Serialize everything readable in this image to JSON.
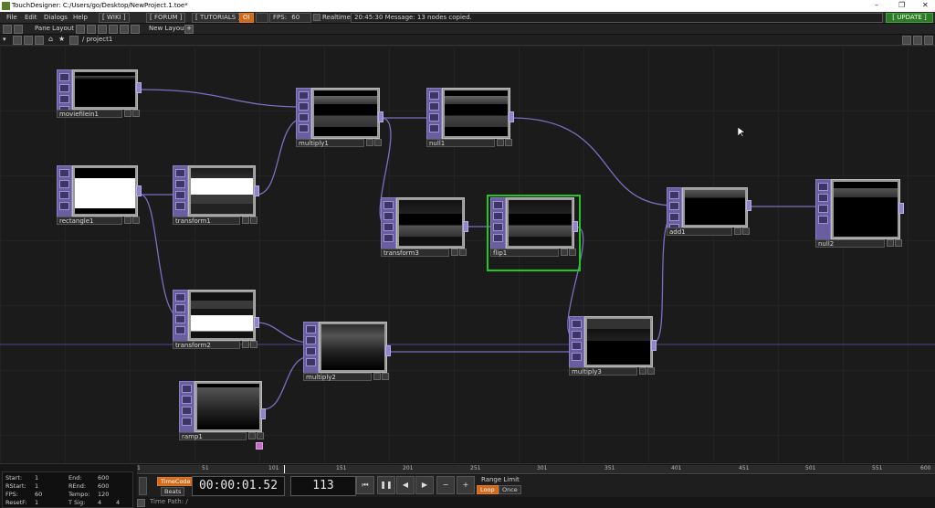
{
  "window": {
    "title": "TouchDesigner: C:/Users/go/Desktop/NewProject.1.toe*"
  },
  "menu": {
    "items": [
      "File",
      "Edit",
      "Dialogs",
      "Help"
    ],
    "wiki": "[ WIKI ]",
    "forum": "[ FORUM ]",
    "tutorials": "[ TUTORIALS ]",
    "oi": "OI",
    "fps_label": "FPS:",
    "fps_value": "60",
    "realtime": "Realtime",
    "message": "20:45:30 Message: 13 nodes copied.",
    "update": "[ UPDATE ]"
  },
  "panebar": {
    "pane_layout": "Pane Layout",
    "new_layout": "New Layout"
  },
  "pathbar": {
    "path": "/ project1"
  },
  "nodes": {
    "moviefilein1": "moviefilein1",
    "rectangle1": "rectangle1",
    "transform1": "transform1",
    "transform2": "transform2",
    "ramp1": "ramp1",
    "multiply1": "multiply1",
    "null1": "null1",
    "transform3": "transform3",
    "flip1": "flip1",
    "multiply2": "multiply2",
    "multiply3": "multiply3",
    "add1": "add1",
    "null2": "null2"
  },
  "stats": {
    "start_label": "Start:",
    "start_value": "1",
    "end_label": "End:",
    "end_value": "600",
    "rstart_label": "RStart:",
    "rstart_value": "1",
    "rend_label": "REnd:",
    "rend_value": "600",
    "fps_label": "FPS:",
    "fps_value": "60",
    "tempo_label": "Tempo:",
    "tempo_value": "120",
    "resetf_label": "ResetF:",
    "resetf_value": "1",
    "tsig_label": "T Sig:",
    "tsig_a": "4",
    "tsig_b": "4"
  },
  "timeline": {
    "ticks": [
      "1",
      "51",
      "101",
      "151",
      "201",
      "251",
      "301",
      "351",
      "401",
      "451",
      "501",
      "551",
      "600"
    ],
    "timecode_button": "TimeCode",
    "beats_button": "Beats",
    "timecode": "00:00:01.52",
    "frame": "113",
    "range_limit": "Range Limit",
    "loop": "Loop",
    "once": "Once",
    "time_path": "Time Path: /"
  },
  "colors": {
    "accent_orange": "#d06a1d",
    "node_purple": "#6b5ea0",
    "selection_green": "#22c822",
    "wire": "#7a6fc0"
  }
}
